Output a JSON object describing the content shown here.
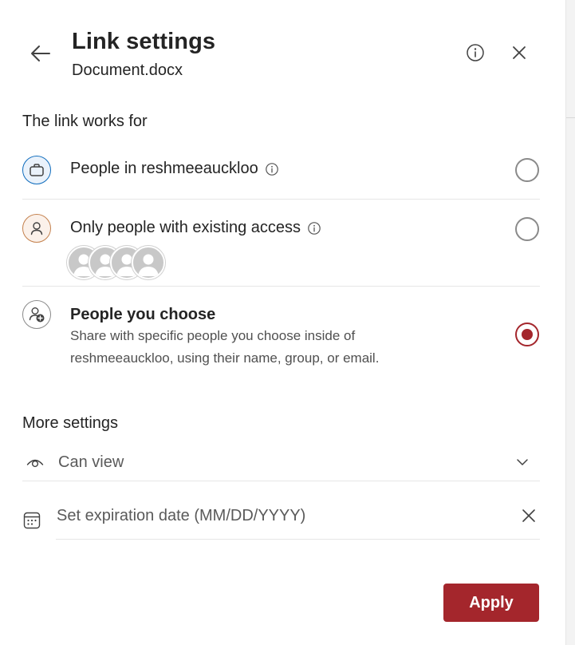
{
  "header": {
    "title": "Link settings",
    "subtitle": "Document.docx",
    "icons": {
      "back": "arrow-left-icon",
      "info": "info-icon",
      "close": "close-icon"
    }
  },
  "link_works_for": {
    "heading": "The link works for",
    "options": [
      {
        "label": "People in reshmeeauckloo",
        "icon": "briefcase-icon",
        "has_info": true,
        "selected": false
      },
      {
        "label": "Only people with existing access",
        "icon": "person-icon",
        "has_info": true,
        "selected": false
      },
      {
        "label": "People you choose",
        "icon": "person-add-icon",
        "selected": true,
        "description_line1": "Share with specific people you choose inside of",
        "description_line2": "reshmeeauckloo, using their name, group, or email."
      }
    ]
  },
  "more_settings": {
    "heading": "More settings",
    "permission": {
      "label": "Can view",
      "icon": "eye-icon"
    },
    "expiration": {
      "placeholder": "Set expiration date (MM/DD/YYYY)",
      "icon": "calendar-icon"
    }
  },
  "footer": {
    "apply_label": "Apply"
  },
  "colors": {
    "accent": "#a4262c",
    "briefcase_ring": "#0f6cbd",
    "person_ring": "#c4814d"
  }
}
